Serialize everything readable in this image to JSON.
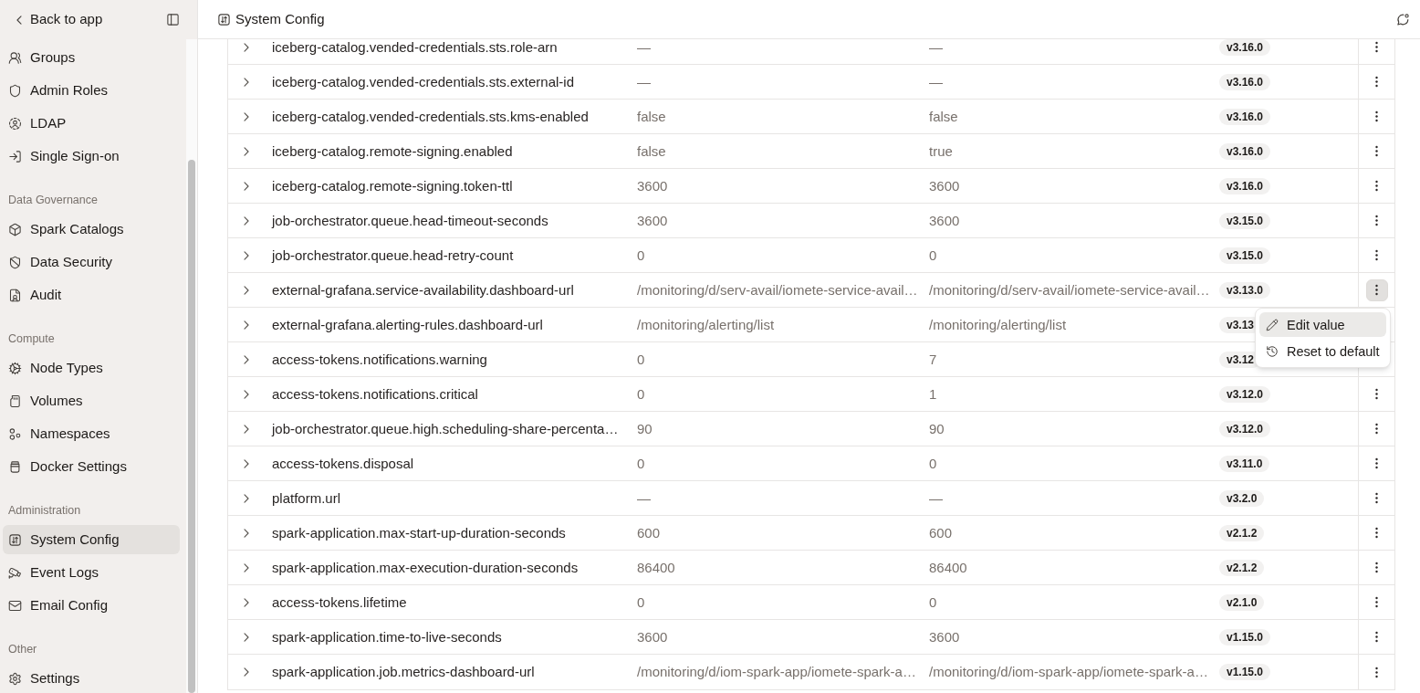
{
  "sidebar": {
    "back_link": "Back to app",
    "sections": [
      {
        "items": [
          {
            "label": "Groups",
            "selected": false
          },
          {
            "label": "Admin Roles",
            "selected": false
          },
          {
            "label": "LDAP",
            "selected": false
          },
          {
            "label": "Single Sign-on",
            "selected": false
          }
        ]
      },
      {
        "title": "Data Governance",
        "items": [
          {
            "label": "Spark Catalogs",
            "selected": false
          },
          {
            "label": "Data Security",
            "selected": false
          },
          {
            "label": "Audit",
            "selected": false
          }
        ]
      },
      {
        "title": "Compute",
        "items": [
          {
            "label": "Node Types",
            "selected": false
          },
          {
            "label": "Volumes",
            "selected": false
          },
          {
            "label": "Namespaces",
            "selected": false
          },
          {
            "label": "Docker Settings",
            "selected": false
          }
        ]
      },
      {
        "title": "Administration",
        "items": [
          {
            "label": "System Config",
            "selected": true
          },
          {
            "label": "Event Logs",
            "selected": false
          },
          {
            "label": "Email Config",
            "selected": false
          }
        ]
      },
      {
        "title": "Other",
        "items": [
          {
            "label": "Settings",
            "selected": false
          }
        ]
      }
    ]
  },
  "header": {
    "title": "System Config"
  },
  "table": {
    "rows": [
      {
        "cells": [
          "iceberg-catalog.vended-credentials.sts.role-arn",
          "—",
          "—"
        ],
        "badge": "v3.16.0",
        "expanded": false,
        "menu_open": false
      },
      {
        "cells": [
          "iceberg-catalog.vended-credentials.sts.external-id",
          "—",
          "—"
        ],
        "badge": "v3.16.0",
        "expanded": false,
        "menu_open": false
      },
      {
        "cells": [
          "iceberg-catalog.vended-credentials.sts.kms-enabled",
          "false",
          "false"
        ],
        "badge": "v3.16.0",
        "expanded": false,
        "menu_open": false
      },
      {
        "cells": [
          "iceberg-catalog.remote-signing.enabled",
          "false",
          "true"
        ],
        "badge": "v3.16.0",
        "expanded": false,
        "menu_open": false
      },
      {
        "cells": [
          "iceberg-catalog.remote-signing.token-ttl",
          "3600",
          "3600"
        ],
        "badge": "v3.16.0",
        "expanded": false,
        "menu_open": false
      },
      {
        "cells": [
          "job-orchestrator.queue.head-timeout-seconds",
          "3600",
          "3600"
        ],
        "badge": "v3.15.0",
        "expanded": false,
        "menu_open": false
      },
      {
        "cells": [
          "job-orchestrator.queue.head-retry-count",
          "0",
          "0"
        ],
        "badge": "v3.15.0",
        "expanded": false,
        "menu_open": false
      },
      {
        "cells": [
          "external-grafana.service-availability.dashboard-url",
          "/monitoring/d/serv-avail/iomete-service-avail…",
          "/monitoring/d/serv-avail/iomete-service-avail…"
        ],
        "badge": "v3.13.0",
        "expanded": false,
        "menu_open": true
      },
      {
        "cells": [
          "external-grafana.alerting-rules.dashboard-url",
          "/monitoring/alerting/list",
          "/monitoring/alerting/list"
        ],
        "badge": "v3.13",
        "expanded": false,
        "menu_open": false
      },
      {
        "cells": [
          "access-tokens.notifications.warning",
          "0",
          "7"
        ],
        "badge": "v3.12",
        "expanded": false,
        "menu_open": false
      },
      {
        "cells": [
          "access-tokens.notifications.critical",
          "0",
          "1"
        ],
        "badge": "v3.12.0",
        "expanded": false,
        "menu_open": false
      },
      {
        "cells": [
          "job-orchestrator.queue.high.scheduling-share-percenta…",
          "90",
          "90"
        ],
        "badge": "v3.12.0",
        "expanded": false,
        "menu_open": false
      },
      {
        "cells": [
          "access-tokens.disposal",
          "0",
          "0"
        ],
        "badge": "v3.11.0",
        "expanded": false,
        "menu_open": false
      },
      {
        "cells": [
          "platform.url",
          "—",
          "—"
        ],
        "badge": "v3.2.0",
        "expanded": false,
        "menu_open": false
      },
      {
        "cells": [
          "spark-application.max-start-up-duration-seconds",
          "600",
          "600"
        ],
        "badge": "v2.1.2",
        "expanded": false,
        "menu_open": false
      },
      {
        "cells": [
          "spark-application.max-execution-duration-seconds",
          "86400",
          "86400"
        ],
        "badge": "v2.1.2",
        "expanded": false,
        "menu_open": false
      },
      {
        "cells": [
          "access-tokens.lifetime",
          "0",
          "0"
        ],
        "badge": "v2.1.0",
        "expanded": false,
        "menu_open": false
      },
      {
        "cells": [
          "spark-application.time-to-live-seconds",
          "3600",
          "3600"
        ],
        "badge": "v1.15.0",
        "expanded": false,
        "menu_open": false
      },
      {
        "cells": [
          "spark-application.job.metrics-dashboard-url",
          "/monitoring/d/iom-spark-app/iomete-spark-a…",
          "/monitoring/d/iom-spark-app/iomete-spark-a…"
        ],
        "badge": "v1.15.0",
        "expanded": false,
        "menu_open": false
      }
    ],
    "row_menu": {
      "items": [
        {
          "label": "Edit value",
          "selected": true
        },
        {
          "label": "Reset to default",
          "selected": false
        }
      ]
    }
  }
}
